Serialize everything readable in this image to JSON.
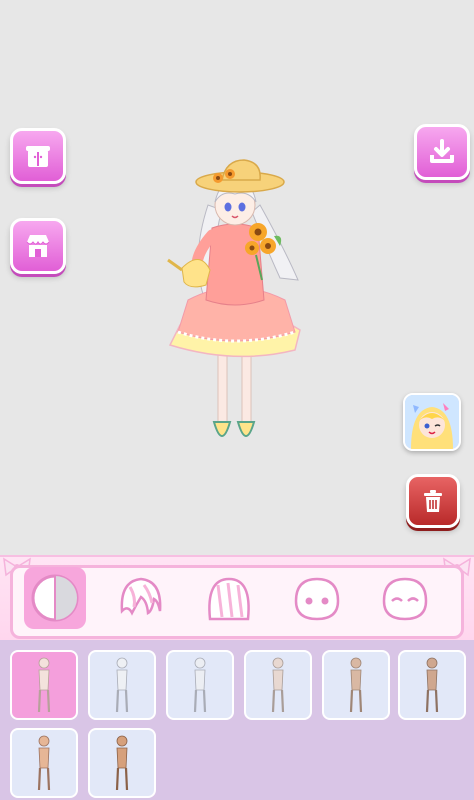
{
  "toolbar": {
    "left_buttons": [
      {
        "icon": "wardrobe-icon"
      },
      {
        "icon": "shop-icon"
      }
    ],
    "right_buttons": [
      {
        "icon": "download-icon"
      },
      {
        "icon": "trash-icon"
      }
    ],
    "ad_icon": "promo-game-icon"
  },
  "categories": [
    {
      "icon": "body-category-icon",
      "active": true
    },
    {
      "icon": "front-hair-category-icon",
      "active": false
    },
    {
      "icon": "back-hair-category-icon",
      "active": false
    },
    {
      "icon": "face-eyes-category-icon",
      "active": false
    },
    {
      "icon": "face-expression-category-icon",
      "active": false
    }
  ],
  "items": {
    "selected_index": 0,
    "skin_tones": [
      "#f3e2dc",
      "#eef0f4",
      "#eceef3",
      "#e8d8d1",
      "#d9b8a3",
      "#cfa78f",
      "#e6b696",
      "#d6a07c"
    ]
  },
  "colors": {
    "accent_pink": "#e15fd6",
    "delete_red": "#c23535",
    "panel_lilac": "#d9c5e6",
    "bar_pink": "#ffd6ee"
  }
}
